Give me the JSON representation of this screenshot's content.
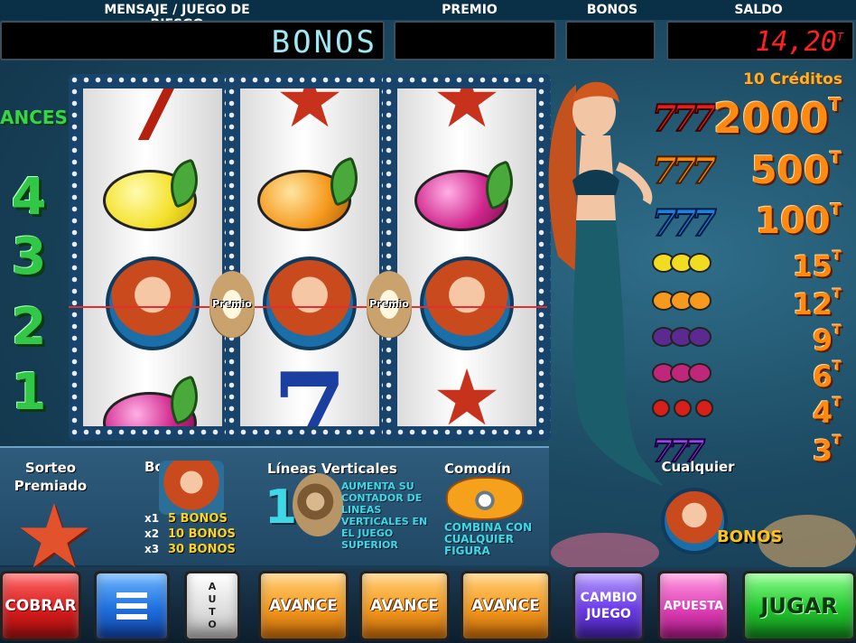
{
  "header": {
    "labels": {
      "mensaje": "MENSAJE / JUEGO DE RIESGO",
      "premio": "PREMIO",
      "bonos": "BONOS",
      "saldo": "SALDO"
    },
    "message_display": "BONOS",
    "premio_display": "",
    "bonos_display": "",
    "saldo_display": "14,20",
    "saldo_unit": "T"
  },
  "avances": {
    "title": "ANCES",
    "levels": [
      "4",
      "3",
      "2",
      "1"
    ]
  },
  "reels": {
    "premio_label": "Premio",
    "columns": [
      [
        "seven",
        "lemon",
        "mermaid",
        "plum"
      ],
      [
        "starfish",
        "orange",
        "mermaid",
        "seven"
      ],
      [
        "starfish",
        "plum",
        "mermaid",
        "starfish"
      ]
    ]
  },
  "paytable": {
    "header": "10 Créditos",
    "unit": "T",
    "rows": [
      {
        "symbol": "red-sevens",
        "icon": "777",
        "color": "#e0201a",
        "value": "2000"
      },
      {
        "symbol": "orange-sevens",
        "icon": "777",
        "color": "#f28a12",
        "value": "500"
      },
      {
        "symbol": "blue-sevens",
        "icon": "777",
        "color": "#1e7fe0",
        "value": "100"
      },
      {
        "symbol": "lemons",
        "icon": "lemon",
        "color": "#f2dc22",
        "value": "15"
      },
      {
        "symbol": "oranges",
        "icon": "orange",
        "color": "#f59a1e",
        "value": "12"
      },
      {
        "symbol": "grapes",
        "icon": "grape",
        "color": "#5b2a90",
        "value": "9"
      },
      {
        "symbol": "plums",
        "icon": "plum",
        "color": "#c0277a",
        "value": "6"
      },
      {
        "symbol": "cherries",
        "icon": "cherry",
        "color": "#d8201a",
        "value": "4"
      },
      {
        "symbol": "any-sevens",
        "icon": "777",
        "color": "#8a4ce0",
        "value": "3"
      }
    ],
    "any_label": "Cualquier",
    "bonos_label": "BONOS"
  },
  "info": {
    "sorteo": {
      "title": "Sorteo Premiado"
    },
    "bonos": {
      "title": "Bonos",
      "multipliers": [
        "x1",
        "x2",
        "x3"
      ],
      "awards": [
        "5 BONOS",
        "10 BONOS",
        "30 BONOS"
      ]
    },
    "lineas": {
      "title": "Líneas Verticales",
      "number": "1",
      "text": "AUMENTA SU CONTADOR DE LINEAS VERTICALES EN EL JUEGO SUPERIOR"
    },
    "comodin": {
      "title": "Comodín",
      "text": "COMBINA CON CUALQUIER FIGURA"
    }
  },
  "buttons": {
    "cobrar": "COBRAR",
    "auto": "AUTO",
    "avance": [
      "AVANCE",
      "AVANCE",
      "AVANCE"
    ],
    "cambio": "CAMBIO JUEGO",
    "apuesta": "APUESTA",
    "jugar": "JUGAR"
  }
}
